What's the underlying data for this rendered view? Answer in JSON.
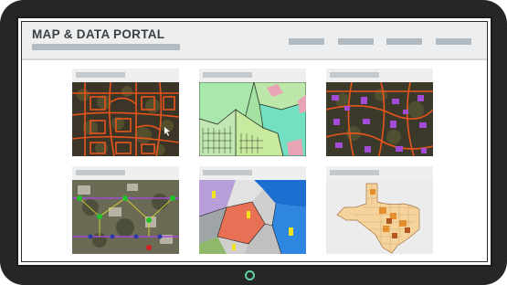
{
  "header": {
    "title": "MAP & DATA PORTAL",
    "subtitle_placeholder": "subtitle-bar",
    "nav_items": [
      "nav-1",
      "nav-2",
      "nav-3",
      "nav-4"
    ]
  },
  "cards": [
    {
      "id": "parcels-streets",
      "map": "orange street grid over dark aerial imagery"
    },
    {
      "id": "zoning",
      "map": "colored zoning polygons"
    },
    {
      "id": "buildings",
      "map": "purple building footprints over aerial imagery"
    },
    {
      "id": "utilities",
      "map": "utility network with nodes over aerial imagery"
    },
    {
      "id": "geology",
      "map": "multicolor geology map"
    },
    {
      "id": "texas-counties",
      "map": "texas counties choropleth"
    }
  ],
  "colors": {
    "device": "#262626",
    "header_bg": "#eceeef",
    "placeholder": "#b1bac0",
    "street": "#e8541c",
    "building": "#a24bd6",
    "home_button": "#5fd0a0"
  }
}
